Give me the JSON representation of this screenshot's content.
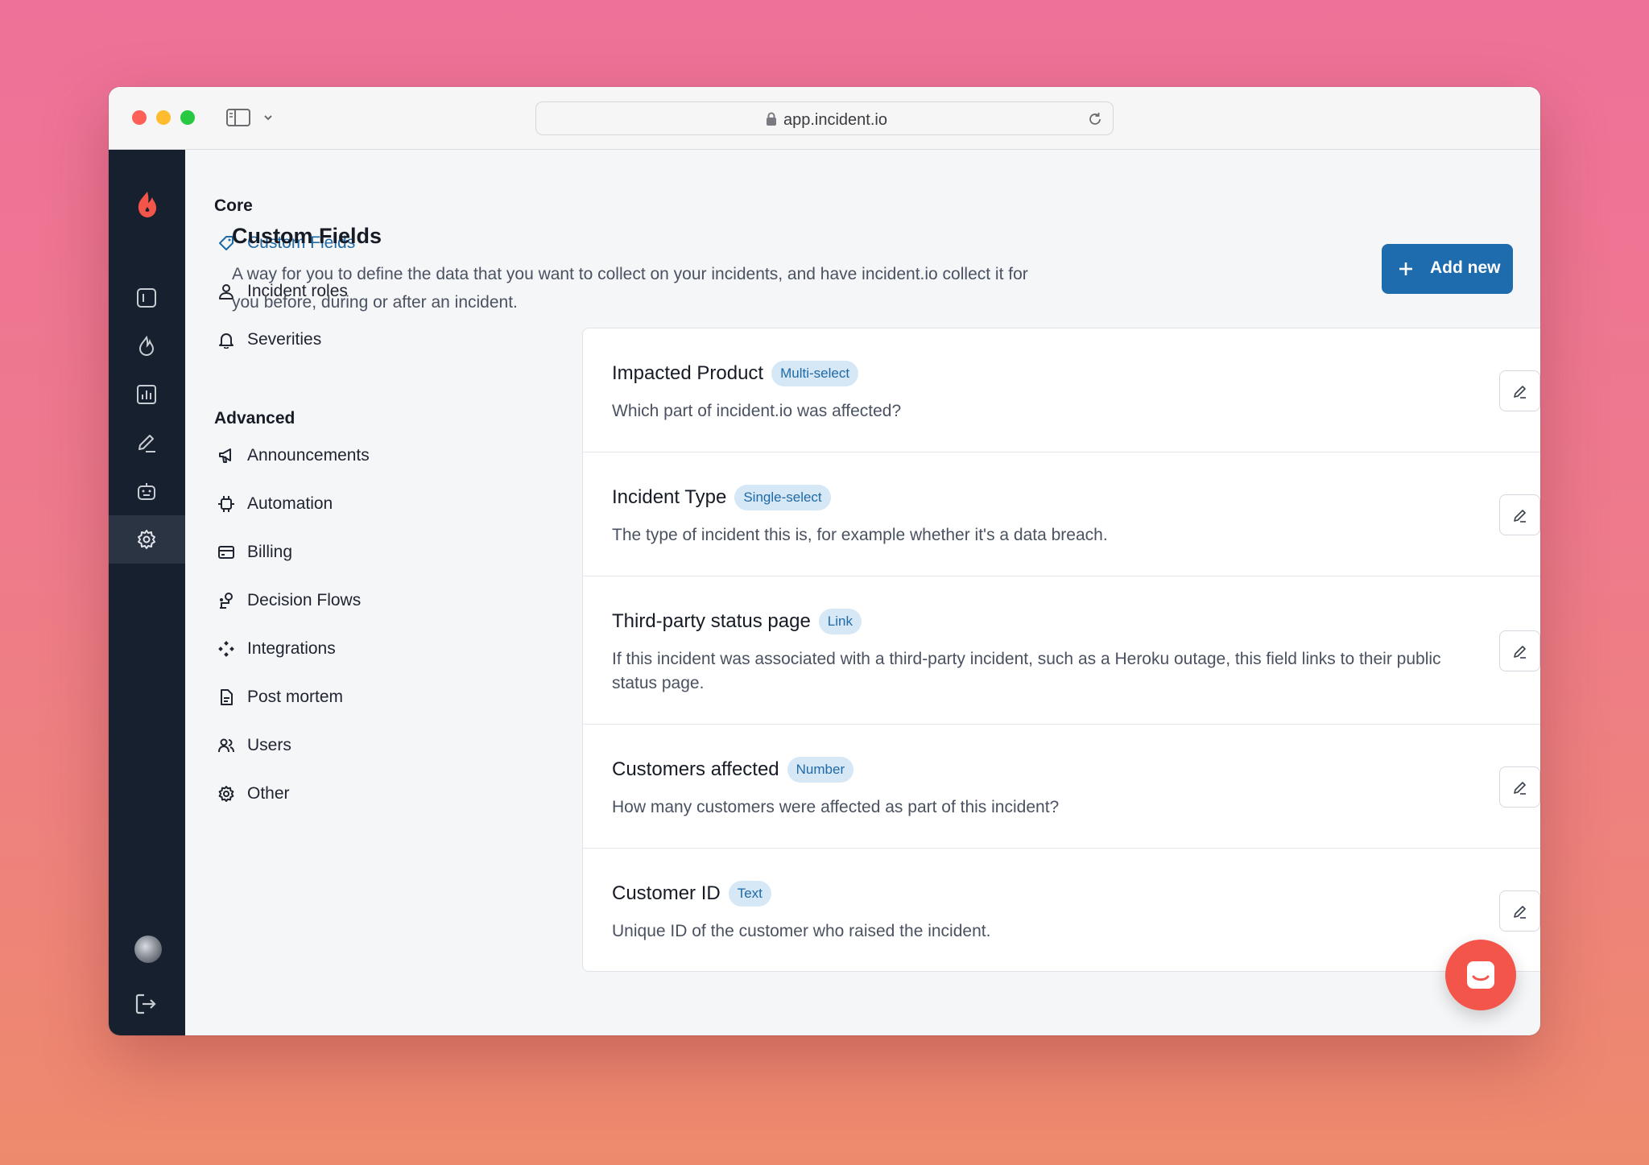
{
  "browser": {
    "url": "app.incident.io",
    "icons": [
      "sidebar-toggle-icon",
      "chevron-down-icon",
      "lock-icon",
      "reload-icon"
    ]
  },
  "rail": {
    "items": [
      {
        "icon": "dashboard-icon"
      },
      {
        "icon": "flame-icon"
      },
      {
        "icon": "chart-icon"
      },
      {
        "icon": "pencil-icon"
      },
      {
        "icon": "bot-icon"
      },
      {
        "icon": "gear-icon",
        "active": true
      }
    ]
  },
  "nav": {
    "core_label": "Core",
    "advanced_label": "Advanced",
    "core_items": [
      {
        "label": "Custom Fields",
        "icon": "tag-icon",
        "active": true
      },
      {
        "label": "Incident roles",
        "icon": "user-icon"
      },
      {
        "label": "Severities",
        "icon": "bell-icon"
      }
    ],
    "advanced_items": [
      {
        "label": "Announcements",
        "icon": "megaphone-icon"
      },
      {
        "label": "Automation",
        "icon": "chip-icon"
      },
      {
        "label": "Billing",
        "icon": "credit-card-icon"
      },
      {
        "label": "Decision Flows",
        "icon": "decision-tree-icon"
      },
      {
        "label": "Integrations",
        "icon": "puzzle-icon"
      },
      {
        "label": "Post mortem",
        "icon": "document-icon"
      },
      {
        "label": "Users",
        "icon": "users-icon"
      },
      {
        "label": "Other",
        "icon": "gear-icon"
      }
    ]
  },
  "page": {
    "title": "Custom Fields",
    "description": "A way for you to define the data that you want to collect on your incidents, and have incident.io collect it for you before, during or after an incident.",
    "add_label": "Add new"
  },
  "fields": [
    {
      "name": "Impacted Product",
      "type": "Multi-select",
      "description": "Which part of incident.io was affected?"
    },
    {
      "name": "Incident Type",
      "type": "Single-select",
      "description": "The type of incident this is, for example whether it's a data breach."
    },
    {
      "name": "Third-party status page",
      "type": "Link",
      "description": "If this incident was associated with a third-party incident, such as a Heroku outage, this field links to their public status page."
    },
    {
      "name": "Customers affected",
      "type": "Number",
      "description": "How many customers were affected as part of this incident?"
    },
    {
      "name": "Customer ID",
      "type": "Text",
      "description": "Unique ID of the customer who raised the incident."
    }
  ],
  "colors": {
    "accent": "#1e6bad",
    "rail": "#17202e",
    "delete": "#e5483d",
    "chat": "#f4554a"
  }
}
